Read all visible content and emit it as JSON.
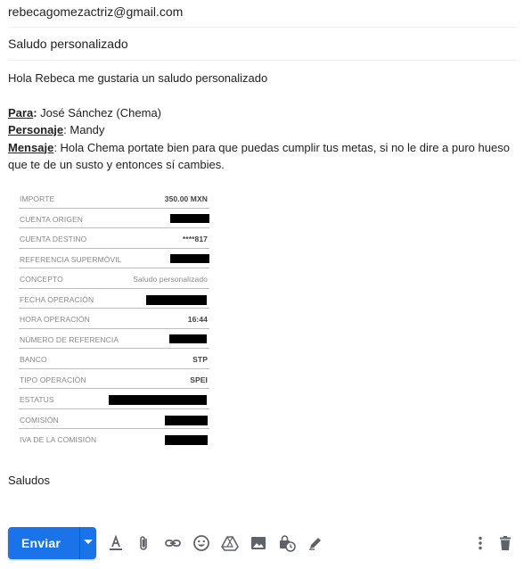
{
  "compose": {
    "to": "rebecagomezactriz@gmail.com",
    "subject": "Saludo personalizado"
  },
  "body": {
    "greeting": "Hola Rebeca me gustaria un saludo personalizado",
    "para_label": "Para",
    "para_colon": ":",
    "para_value": " José Sánchez (Chema)",
    "personaje_label": "Personaje",
    "personaje_value": ": Mandy",
    "mensaje_label": "Mensaje",
    "mensaje_value": ": Hola Chema portate bien para que puedas cumplir tus metas, si no le dire a puro hueso que te de un susto y entonces sí cambies.",
    "closing": "Saludos"
  },
  "receipt": {
    "rows": [
      {
        "label": "IMPORTE",
        "value": "350.00 MXN"
      },
      {
        "label": "CUENTA ORIGEN",
        "value": ""
      },
      {
        "label": "CUENTA DESTINO",
        "value": "****817"
      },
      {
        "label": "REFERENCIA SUPERMÓVIL",
        "value": ""
      },
      {
        "label": "CONCEPTO",
        "value": "Saludo personalizado"
      },
      {
        "label": "FECHA OPERACIÓN",
        "value": ""
      },
      {
        "label": "HORA OPERACIÓN",
        "value": "16:44"
      },
      {
        "label": "NÚMERO DE REFERENCIA",
        "value": ""
      },
      {
        "label": "BANCO",
        "value": "STP"
      },
      {
        "label": "TIPO OPERACIÓN",
        "value": "SPEI"
      },
      {
        "label": "ESTATUS",
        "value": ""
      },
      {
        "label": "COMISIÓN",
        "value": ""
      },
      {
        "label": "IVA DE LA COMISIÓN",
        "value": ""
      }
    ]
  },
  "toolbar": {
    "send_label": "Enviar",
    "icons": [
      "formatting-icon",
      "attach-icon",
      "link-icon",
      "emoji-icon",
      "drive-icon",
      "photo-icon",
      "confidential-icon",
      "signature-icon",
      "more-options-icon",
      "discard-icon"
    ]
  },
  "colors": {
    "accent": "#1a73e8",
    "icon": "#5f6368",
    "text": "#222222"
  }
}
